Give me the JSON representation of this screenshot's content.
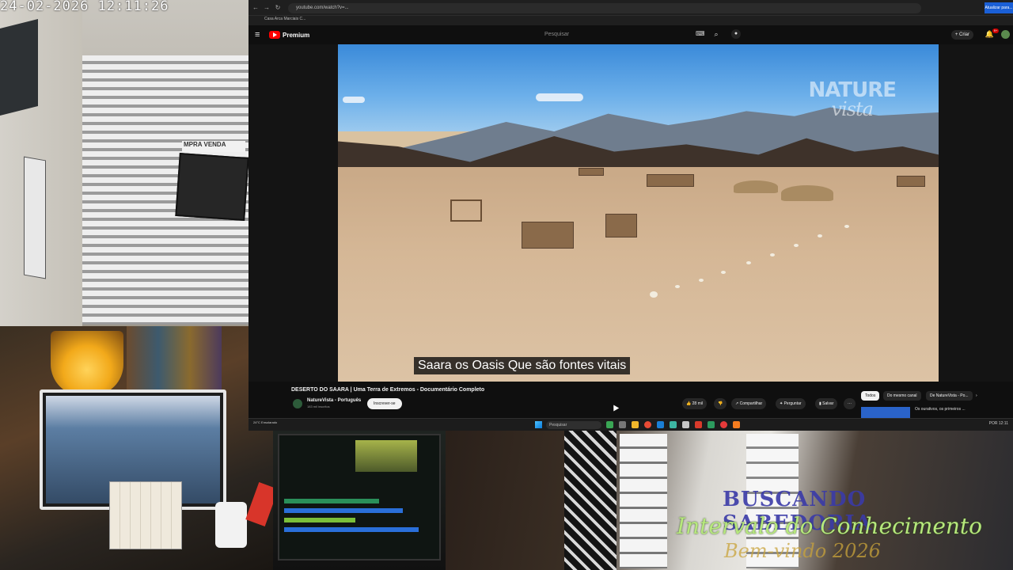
{
  "cameras": {
    "street_timestamp": "24-02-2026 12:11:26",
    "street_sign": "MPRA   VENDA",
    "overlay_title": "BUSCANDO SABEDORIA",
    "overlay_subtitle": "Intervalo do Conhecimento",
    "overlay_tagline": "Bem-vindo 2026"
  },
  "browser": {
    "url": "youtube.com/watch?v=...",
    "bookmark": "Casa Arca Marciais C...",
    "profile_badge": "Atualizar para...",
    "youtube": {
      "logo_text": "Premium",
      "search_placeholder": "Pesquisar",
      "create_label": "+ Criar",
      "notification_count": "9+"
    },
    "video": {
      "watermark_line1": "NATURE",
      "watermark_line2": "vista",
      "subtitle": "Saara os Oasis Que são fontes vitais",
      "title": "DESERTO DO SAARA | Uma Terra de Extremos - Documentário Completo",
      "channel_name": "NatureVista - Português",
      "subscribers": "183 mil inscritos",
      "subscribe_label": "Inscrever-se",
      "like_count": "28 mil",
      "share_label": "Compartilhar",
      "ask_label": "Perguntar",
      "save_label": "Salvar",
      "more_label": "···"
    },
    "chips": [
      "Todos",
      "Do mesmo canal",
      "De NatureVista - Po..."
    ],
    "recommended_text": "Os ourativos, os primeiros ...",
    "taskbar": {
      "weather": "24°C Ensolarado",
      "search_label": "Pesquisar",
      "tray": "POR  12:11"
    }
  }
}
